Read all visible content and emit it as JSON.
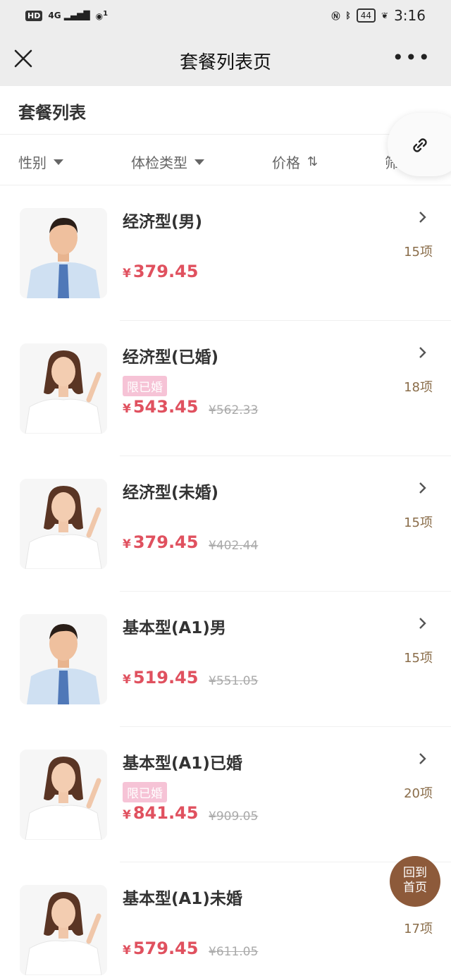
{
  "status_bar": {
    "network": "HD",
    "signal": "4G",
    "wifi_count": "1",
    "battery": "44",
    "time": "3:16"
  },
  "nav": {
    "title": "套餐列表页",
    "more": "•••"
  },
  "section": {
    "title": "套餐列表"
  },
  "filters": [
    {
      "label": "性别"
    },
    {
      "label": "体检类型"
    },
    {
      "label": "价格",
      "sort_icon": "⇅"
    },
    {
      "label": "筛"
    }
  ],
  "colors": {
    "price": "#e0515f",
    "tag_bg": "#f6c3d6",
    "count": "#8a6d4a",
    "home_btn": "#8d5a3a"
  },
  "packages": [
    {
      "name": "经济型(男)",
      "gender": "male",
      "tag": "",
      "price": "379.45",
      "old_price": "",
      "count": "15项"
    },
    {
      "name": "经济型(已婚)",
      "gender": "female",
      "tag": "限已婚",
      "price": "543.45",
      "old_price": "¥562.33",
      "count": "18项"
    },
    {
      "name": "经济型(未婚)",
      "gender": "female",
      "tag": "",
      "price": "379.45",
      "old_price": "¥402.44",
      "count": "15项"
    },
    {
      "name": "基本型(A1)男",
      "gender": "male",
      "tag": "",
      "price": "519.45",
      "old_price": "¥551.05",
      "count": "15项"
    },
    {
      "name": "基本型(A1)已婚",
      "gender": "female",
      "tag": "限已婚",
      "price": "841.45",
      "old_price": "¥909.05",
      "count": "20项"
    },
    {
      "name": "基本型(A1)未婚",
      "gender": "female",
      "tag": "",
      "price": "579.45",
      "old_price": "¥611.05",
      "count": "17项"
    }
  ],
  "currency": "¥",
  "home_button": {
    "line1": "回到",
    "line2": "首页"
  }
}
